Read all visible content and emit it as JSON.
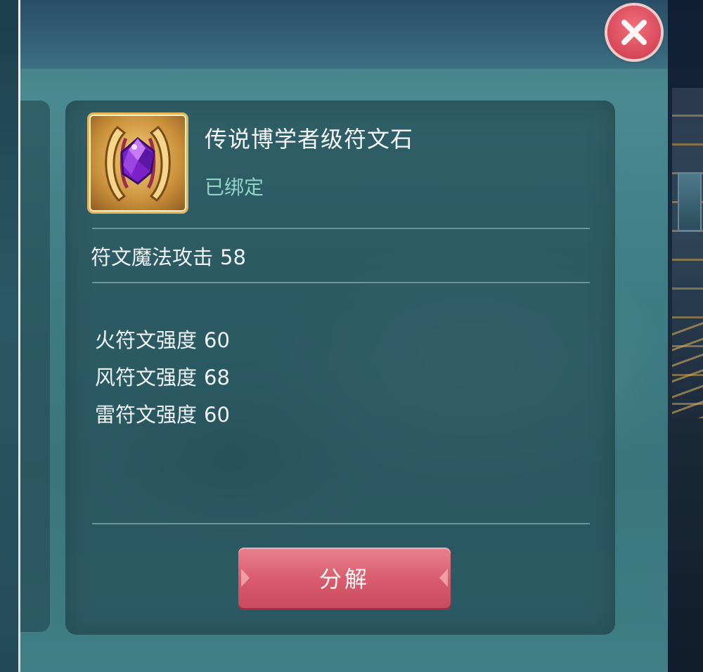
{
  "item": {
    "name": "传说博学者级符文石",
    "bind_status": "已绑定",
    "icon": "purple-runestone-gold-frame-icon"
  },
  "main_stat": {
    "label": "符文魔法攻击",
    "value": "58"
  },
  "rune_strengths": [
    {
      "label": "火符文强度",
      "value": "60"
    },
    {
      "label": "风符文强度",
      "value": "68"
    },
    {
      "label": "雷符文强度",
      "value": "60"
    }
  ],
  "actions": {
    "decompose_label": "分解"
  },
  "colors": {
    "panel_bg": "#3a747d",
    "bind_text": "#8fd6c6",
    "button_red": "#d95d6f",
    "close_red": "#d8485a"
  }
}
